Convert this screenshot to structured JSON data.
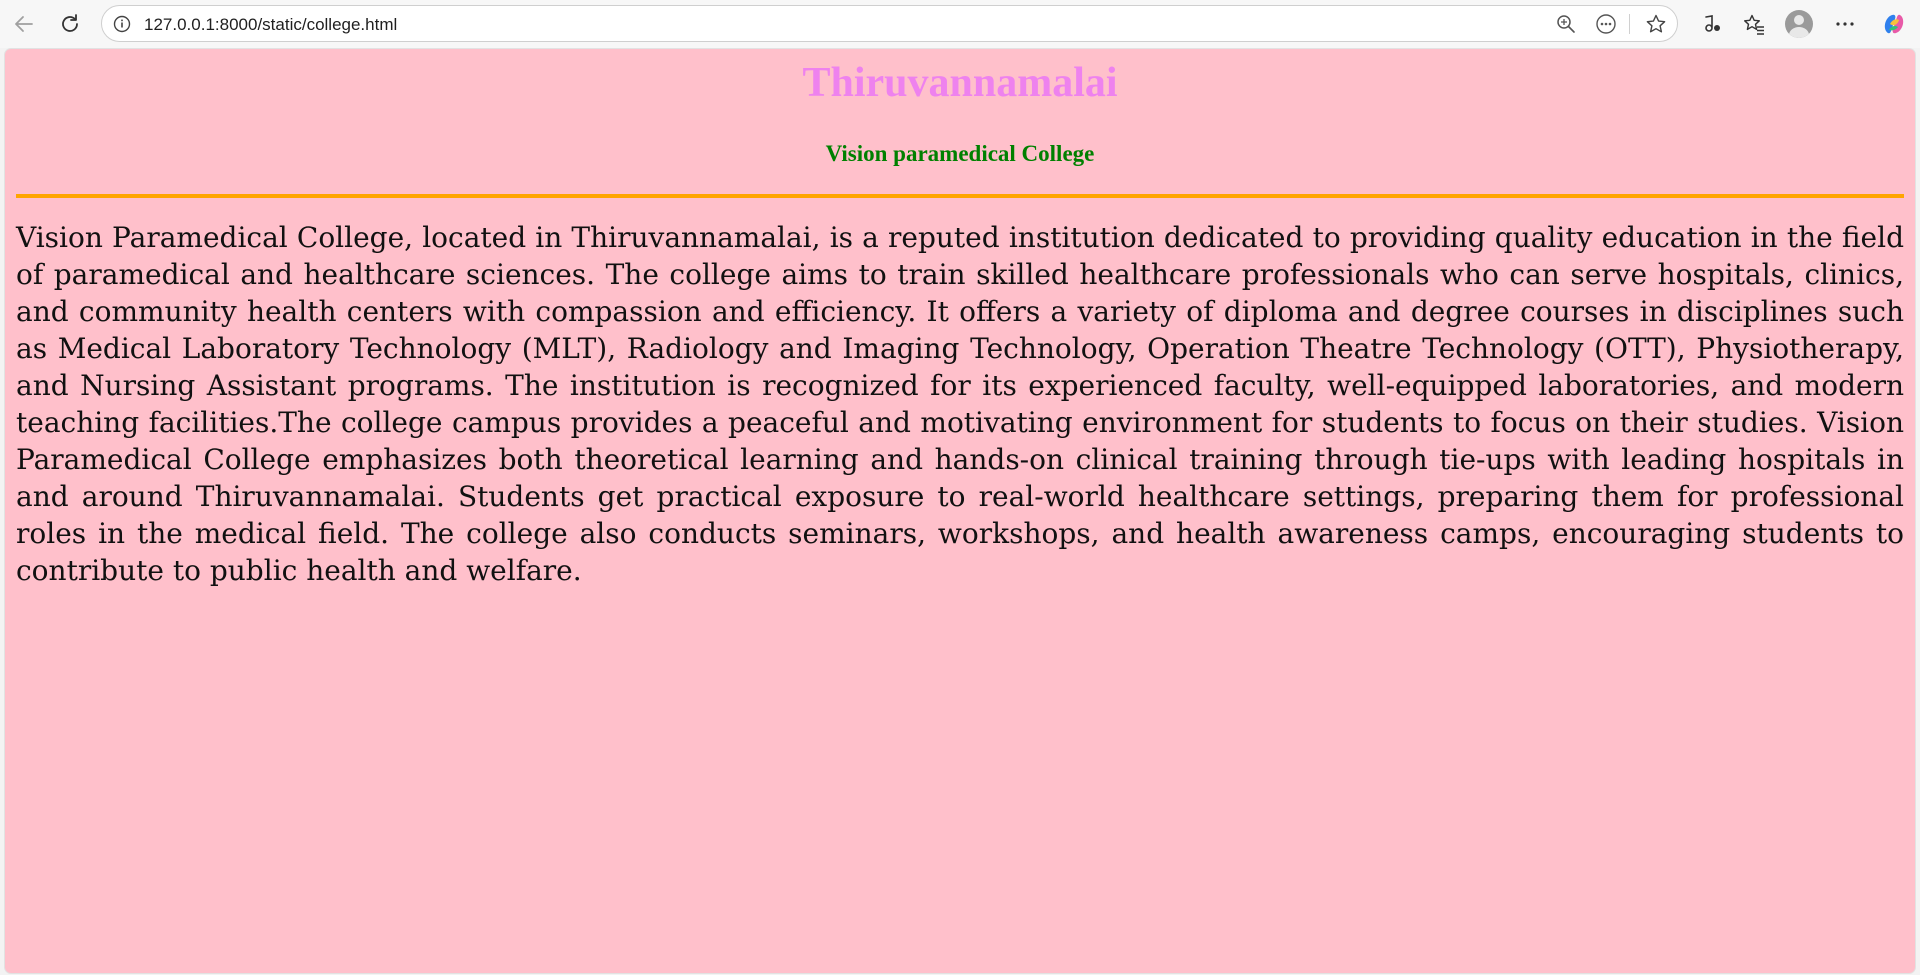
{
  "browser": {
    "url": "127.0.0.1:8000/static/college.html"
  },
  "page": {
    "title": "Thiruvannamalai",
    "subtitle": "Vision paramedical College",
    "description": "Vision Paramedical College, located in Thiruvannamalai, is a reputed institution dedicated to providing quality education in the field of paramedical and healthcare sciences. The college aims to train skilled healthcare professionals who can serve hospitals, clinics, and community health centers with compassion and efficiency. It offers a variety of diploma and degree courses in disciplines such as Medical Laboratory Technology (MLT), Radiology and Imaging Technology, Operation Theatre Technology (OTT), Physiotherapy, and Nursing Assistant programs. The institution is recognized for its experienced faculty, well-equipped laboratories, and modern teaching facilities.The college campus provides a peaceful and motivating environment for students to focus on their studies. Vision Paramedical College emphasizes both theoretical learning and hands-on clinical training through tie-ups with leading hospitals in and around Thiruvannamalai. Students get practical exposure to real-world healthcare settings, preparing them for professional roles in the medical field. The college also conducts seminars, workshops, and health awareness camps, encouraging students to contribute to public health and welfare."
  },
  "colors": {
    "background": "#ffc0cb",
    "title": "#ee82ee",
    "subtitle": "#008000",
    "divider": "#ffa500"
  },
  "icons": [
    "back-arrow-icon",
    "refresh-icon",
    "info-icon",
    "zoom-icon",
    "more-circle-icon",
    "star-icon",
    "media-icon",
    "favorites-icon",
    "avatar",
    "ellipsis-icon",
    "copilot-icon"
  ]
}
